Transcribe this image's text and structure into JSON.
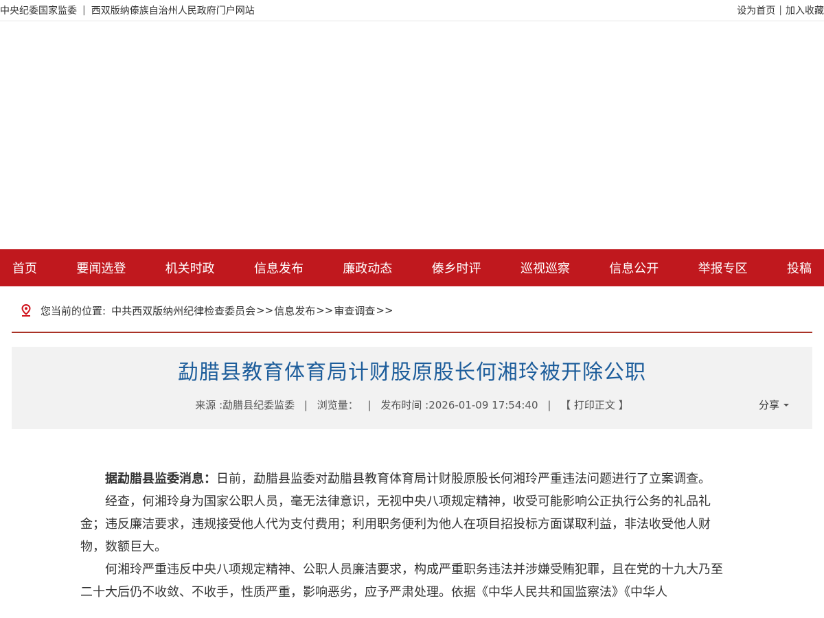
{
  "topbar": {
    "left_links": [
      "中央纪委国家监委",
      "西双版纳傣族自治州人民政府门户网站"
    ],
    "sep": "|",
    "right_links": [
      "设为首页",
      "加入收藏"
    ]
  },
  "nav": {
    "items": [
      "首页",
      "要闻选登",
      "机关时政",
      "信息发布",
      "廉政动态",
      "傣乡时评",
      "巡视巡察",
      "信息公开",
      "举报专区",
      "投稿"
    ]
  },
  "breadcrumb": {
    "icon": "location-pin-icon",
    "label": "您当前的位置:",
    "items": [
      "中共西双版纳州纪律检查委员会",
      "信息发布",
      "审查调查"
    ],
    "sep": ">>"
  },
  "article": {
    "title": "勐腊县教育体育局计财股原股长何湘玲被开除公职",
    "meta": {
      "source": "来源 :勐腊县纪委监委",
      "views": "浏览量：",
      "published": "发布时间 :2026-01-09 17:54:40",
      "print": "【 打印正文 】",
      "sep": "|"
    },
    "share": "分享",
    "lead_bold": "据勐腊县监委消息：",
    "p1": "日前，勐腊县监委对勐腊县教育体育局计财股原股长何湘玲严重违法问题进行了立案调查。",
    "p2": "经查，何湘玲身为国家公职人员，毫无法律意识，无视中央八项规定精神，收受可能影响公正执行公务的礼品礼金；违反廉洁要求，违规接受他人代为支付费用；利用职务便利为他人在项目招投标方面谋取利益，非法收受他人财物，数额巨大。",
    "p3": "何湘玲严重违反中央八项规定精神、公职人员廉洁要求，构成严重职务违法并涉嫌受贿犯罪，且在党的十九大乃至二十大后仍不收敛、不收手，性质严重，影响恶劣，应予严肃处理。依据《中华人民共和国监察法》《中华人"
  },
  "colors": {
    "nav_bg": "#c0181e",
    "title": "#1d5d9b",
    "crumb_border": "#a93226",
    "pin": "#d0121b"
  }
}
